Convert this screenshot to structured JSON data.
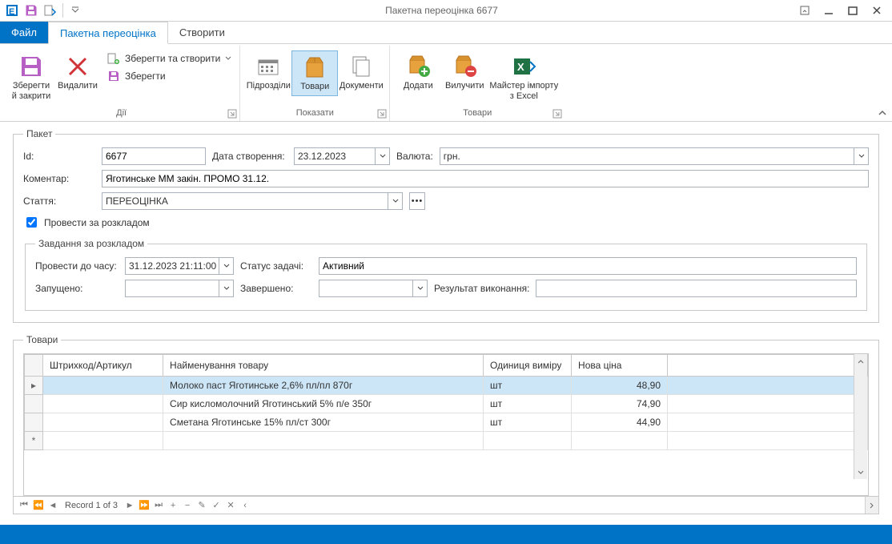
{
  "window": {
    "title": "Пакетна переоцінка 6677"
  },
  "tabs": {
    "file": "Файл",
    "active": "Пакетна переоцінка",
    "create": "Створити"
  },
  "ribbon": {
    "save_close": "Зберегти й закрити",
    "delete": "Видалити",
    "save_and_new": "Зберегти та створити",
    "save": "Зберегти",
    "group_actions": "Дії",
    "divisions": "Підрозділи",
    "goods": "Товари",
    "documents": "Документи",
    "group_show": "Показати",
    "add": "Додати",
    "remove": "Вилучити",
    "import_excel": "Майстер імпорту з Excel",
    "group_goods": "Товари"
  },
  "packet": {
    "legend": "Пакет",
    "id_label": "Id:",
    "id_value": "6677",
    "date_label": "Дата створення:",
    "date_value": "23.12.2023",
    "currency_label": "Валюта:",
    "currency_value": "грн.",
    "comment_label": "Коментар:",
    "comment_value": "Яготинське ММ закін. ПРОМО 31.12.",
    "article_label": "Стаття:",
    "article_value": "ПЕРЕОЦІНКА",
    "schedule_checkbox": "Провести за розкладом"
  },
  "schedule": {
    "legend": "Завдання за розкладом",
    "run_before_label": "Провести до часу:",
    "run_before_value": "31.12.2023 21:11:00",
    "status_label": "Статус задачі:",
    "status_value": "Активний",
    "started_label": "Запущено:",
    "started_value": "",
    "finished_label": "Завершено:",
    "finished_value": "",
    "result_label": "Результат виконання:",
    "result_value": ""
  },
  "goods": {
    "legend": "Товари",
    "col_barcode": "Штрихкод/Артикул",
    "col_name": "Найменування товару",
    "col_unit": "Одиниця виміру",
    "col_price": "Нова ціна",
    "rows": [
      {
        "barcode": "",
        "name": "Молоко паст Яготинське 2,6% пл/пл 870г",
        "unit": "шт",
        "price": "48,90"
      },
      {
        "barcode": "",
        "name": "Сир кисломолочний Яготинський 5% п/е 350г",
        "unit": "шт",
        "price": "74,90"
      },
      {
        "barcode": "",
        "name": "Сметана Яготинське 15% пл/ст 300г",
        "unit": "шт",
        "price": "44,90"
      }
    ],
    "record_text": "Record 1 of 3"
  }
}
